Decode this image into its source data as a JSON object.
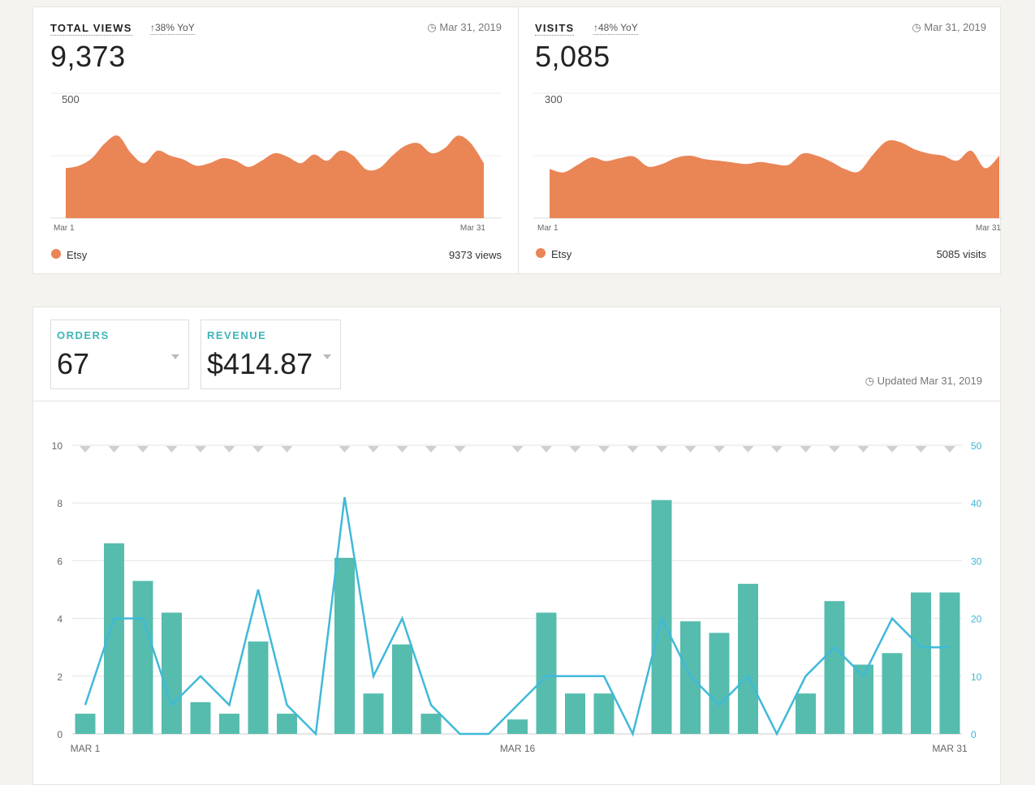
{
  "views": {
    "label": "TOTAL VIEWS",
    "yoy": "38% YoY",
    "date": "Mar 31, 2019",
    "value": "9,373",
    "legend": "Etsy",
    "total": "9373 views",
    "chart_data": {
      "type": "area",
      "series": [
        {
          "name": "Etsy",
          "values": [
            200,
            210,
            240,
            300,
            330,
            260,
            220,
            270,
            250,
            235,
            210,
            220,
            240,
            230,
            205,
            230,
            260,
            245,
            220,
            255,
            230,
            270,
            250,
            195,
            200,
            250,
            290,
            300,
            260,
            280,
            330,
            300,
            220
          ]
        }
      ],
      "ymax": 500,
      "ytick": "500",
      "xlabels": [
        "Mar 1",
        "Mar 31"
      ]
    }
  },
  "visits": {
    "label": "VISITS",
    "yoy": "48% YoY",
    "date": "Mar 31, 2019",
    "value": "5,085",
    "legend": "Etsy",
    "total": "5085 visits",
    "chart_data": {
      "type": "area",
      "series": [
        {
          "name": "Etsy",
          "values": [
            118,
            110,
            128,
            146,
            137,
            144,
            148,
            124,
            130,
            145,
            150,
            142,
            138,
            134,
            130,
            135,
            130,
            128,
            155,
            150,
            136,
            118,
            112,
            152,
            185,
            182,
            165,
            155,
            150,
            138,
            162,
            120,
            150
          ]
        }
      ],
      "ymax": 300,
      "ytick": "300",
      "xlabels": [
        "Mar 1",
        "Mar 31"
      ]
    }
  },
  "orders": {
    "label": "ORDERS",
    "value": "67"
  },
  "revenue": {
    "label": "REVENUE",
    "value": "$414.87"
  },
  "updated": "Updated Mar 31, 2019",
  "chart_data": {
    "type": "bar",
    "categories": [
      "1",
      "2",
      "3",
      "4",
      "5",
      "6",
      "7",
      "8",
      "9",
      "10",
      "11",
      "12",
      "13",
      "14",
      "15",
      "16",
      "17",
      "18",
      "19",
      "20",
      "21",
      "22",
      "23",
      "24",
      "25",
      "26",
      "27",
      "28",
      "29",
      "30",
      "31"
    ],
    "series": [
      {
        "name": "Orders",
        "type": "bar",
        "axis": "left",
        "color": "#56bcae",
        "values": [
          0.7,
          6.6,
          5.3,
          4.2,
          1.1,
          0.7,
          3.2,
          0.7,
          0,
          6.1,
          1.4,
          3.1,
          0.7,
          0,
          0,
          0.5,
          4.2,
          1.4,
          1.4,
          0,
          8.1,
          3.9,
          3.5,
          5.2,
          0,
          1.4,
          4.6,
          2.4,
          2.8,
          4.9,
          4.9
        ]
      },
      {
        "name": "Revenue",
        "type": "line",
        "axis": "right",
        "color": "#40b9d8",
        "values": [
          5,
          20,
          20,
          5,
          10,
          5,
          25,
          5,
          0,
          41,
          10,
          20,
          5,
          0,
          0,
          5,
          10,
          10,
          10,
          0,
          20,
          10,
          5,
          10,
          0,
          10,
          15,
          10,
          20,
          15,
          15
        ]
      }
    ],
    "left_axis": {
      "ticks": [
        "0",
        "2",
        "4",
        "6",
        "8",
        "10"
      ],
      "range": [
        0,
        10
      ]
    },
    "right_axis": {
      "ticks": [
        "0",
        "10",
        "20",
        "30",
        "40",
        "50"
      ],
      "range": [
        0,
        50
      ]
    },
    "xlabels": [
      {
        "index": 0,
        "label": "MAR 1"
      },
      {
        "index": 15,
        "label": "MAR 16"
      },
      {
        "index": 30,
        "label": "MAR 31"
      }
    ],
    "markers": [
      1,
      1,
      1,
      1,
      1,
      1,
      1,
      1,
      0,
      1,
      1,
      1,
      1,
      1,
      0,
      1,
      1,
      1,
      1,
      1,
      1,
      1,
      1,
      1,
      1,
      1,
      1,
      1,
      1,
      1,
      1
    ]
  }
}
